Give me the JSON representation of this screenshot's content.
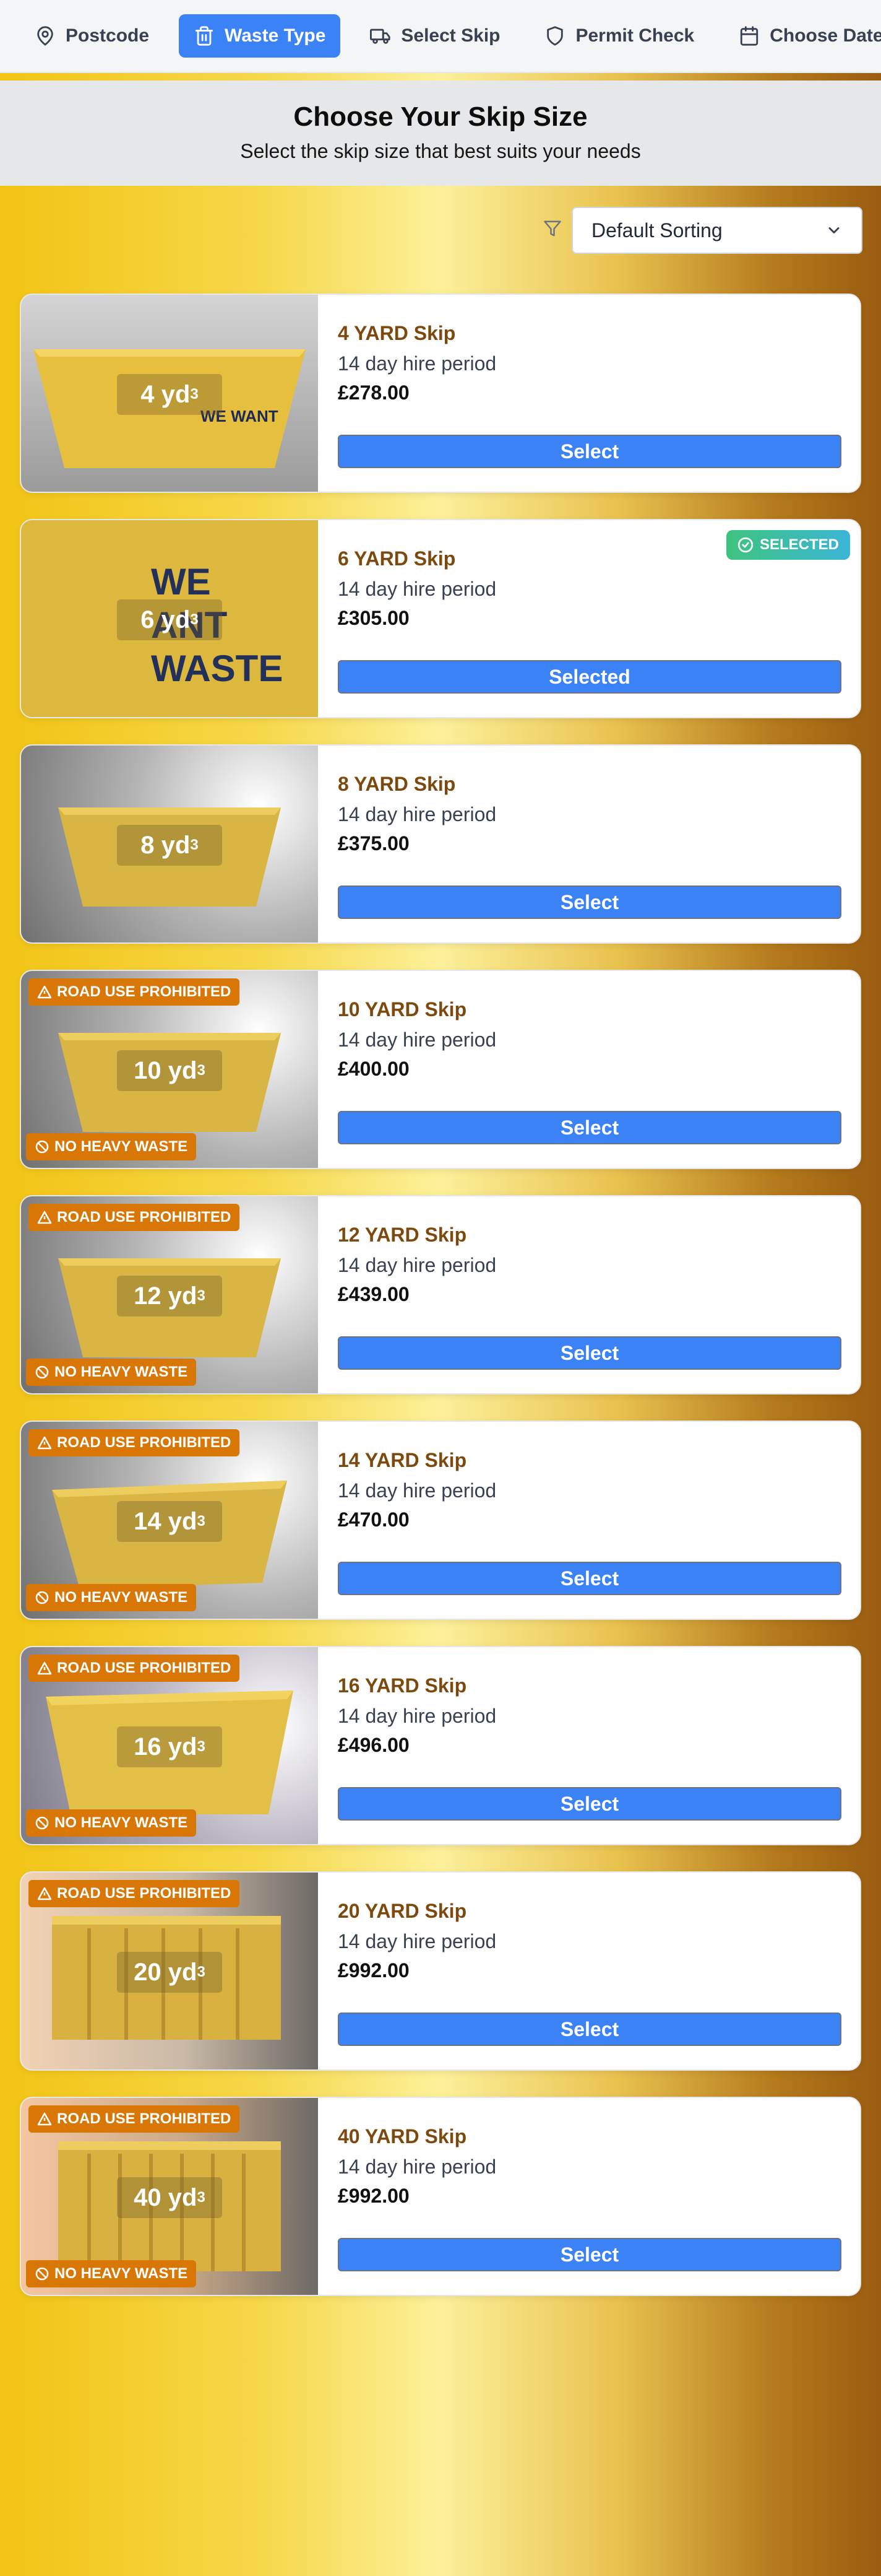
{
  "steps": [
    {
      "label": "Postcode",
      "icon": "map-pin-icon",
      "active": false
    },
    {
      "label": "Waste Type",
      "icon": "trash-icon",
      "active": true
    },
    {
      "label": "Select Skip",
      "icon": "truck-icon",
      "active": false
    },
    {
      "label": "Permit Check",
      "icon": "shield-icon",
      "active": false
    },
    {
      "label": "Choose Date",
      "icon": "calendar-icon",
      "active": false
    }
  ],
  "header": {
    "title": "Choose Your Skip Size",
    "subtitle": "Select the skip size that best suits your needs"
  },
  "sort": {
    "selected": "Default Sorting"
  },
  "badges": {
    "road": "ROAD USE PROHIBITED",
    "heavy": "NO HEAVY WASTE",
    "selected": "SELECTED"
  },
  "buttons": {
    "select": "Select",
    "selected": "Selected"
  },
  "skips": [
    {
      "size": "4 yd",
      "title": "4 YARD Skip",
      "period": "14 day hire period",
      "price": "£278.00",
      "selected": false,
      "road_prohibited": false,
      "no_heavy": false
    },
    {
      "size": "6 yd",
      "title": "6 YARD Skip",
      "period": "14 day hire period",
      "price": "£305.00",
      "selected": true,
      "road_prohibited": false,
      "no_heavy": false
    },
    {
      "size": "8 yd",
      "title": "8 YARD Skip",
      "period": "14 day hire period",
      "price": "£375.00",
      "selected": false,
      "road_prohibited": false,
      "no_heavy": false
    },
    {
      "size": "10 yd",
      "title": "10 YARD Skip",
      "period": "14 day hire period",
      "price": "£400.00",
      "selected": false,
      "road_prohibited": true,
      "no_heavy": true
    },
    {
      "size": "12 yd",
      "title": "12 YARD Skip",
      "period": "14 day hire period",
      "price": "£439.00",
      "selected": false,
      "road_prohibited": true,
      "no_heavy": true
    },
    {
      "size": "14 yd",
      "title": "14 YARD Skip",
      "period": "14 day hire period",
      "price": "£470.00",
      "selected": false,
      "road_prohibited": true,
      "no_heavy": true
    },
    {
      "size": "16 yd",
      "title": "16 YARD Skip",
      "period": "14 day hire period",
      "price": "£496.00",
      "selected": false,
      "road_prohibited": true,
      "no_heavy": true
    },
    {
      "size": "20 yd",
      "title": "20 YARD Skip",
      "period": "14 day hire period",
      "price": "£992.00",
      "selected": false,
      "road_prohibited": true,
      "no_heavy": false
    },
    {
      "size": "40 yd",
      "title": "40 YARD Skip",
      "period": "14 day hire period",
      "price": "£992.00",
      "selected": false,
      "road_prohibited": true,
      "no_heavy": true
    }
  ],
  "colors": {
    "accent": "#3b82f6",
    "warning_badge": "#d97706",
    "title_brown": "#7c4a0e",
    "selected_badge": "#3ec37e"
  }
}
